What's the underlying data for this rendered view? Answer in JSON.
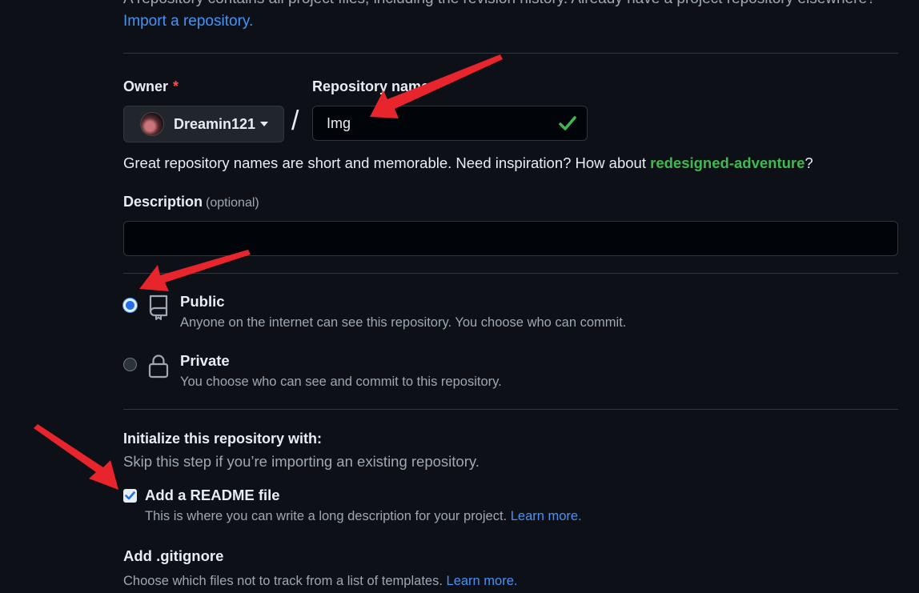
{
  "intro": {
    "text": "A repository contains all project files, including the revision history. Already have a project repository elsewhere?",
    "import_link": "Import a repository."
  },
  "owner": {
    "label": "Owner",
    "required_mark": "*",
    "name": "Dreamin121"
  },
  "repo": {
    "label": "Repository name",
    "value": "Img",
    "separator": "/"
  },
  "hint": {
    "before": "Great repository names are short and memorable. Need inspiration? How about ",
    "suggestion": "redesigned-adventure",
    "after": "?"
  },
  "description": {
    "label": "Description",
    "optional": "(optional)",
    "value": ""
  },
  "visibility": {
    "public": {
      "title": "Public",
      "desc": "Anyone on the internet can see this repository. You choose who can commit.",
      "selected": true
    },
    "private": {
      "title": "Private",
      "desc": "You choose who can see and commit to this repository.",
      "selected": false
    }
  },
  "initialize": {
    "title": "Initialize this repository with:",
    "subtitle": "Skip this step if you’re importing an existing repository.",
    "readme": {
      "label": "Add a README file",
      "desc": "This is where you can write a long description for your project.",
      "link": "Learn more.",
      "checked": true
    }
  },
  "gitignore": {
    "title": "Add .gitignore",
    "desc": "Choose which files not to track from a list of templates.",
    "link": "Learn more."
  },
  "colors": {
    "background": "#0d1117",
    "accent_link": "#4493f8",
    "success": "#3fb950",
    "annotation_arrow": "#e8242c"
  },
  "icons": {
    "public": "repo-icon",
    "private": "lock-icon",
    "valid": "check-icon"
  }
}
